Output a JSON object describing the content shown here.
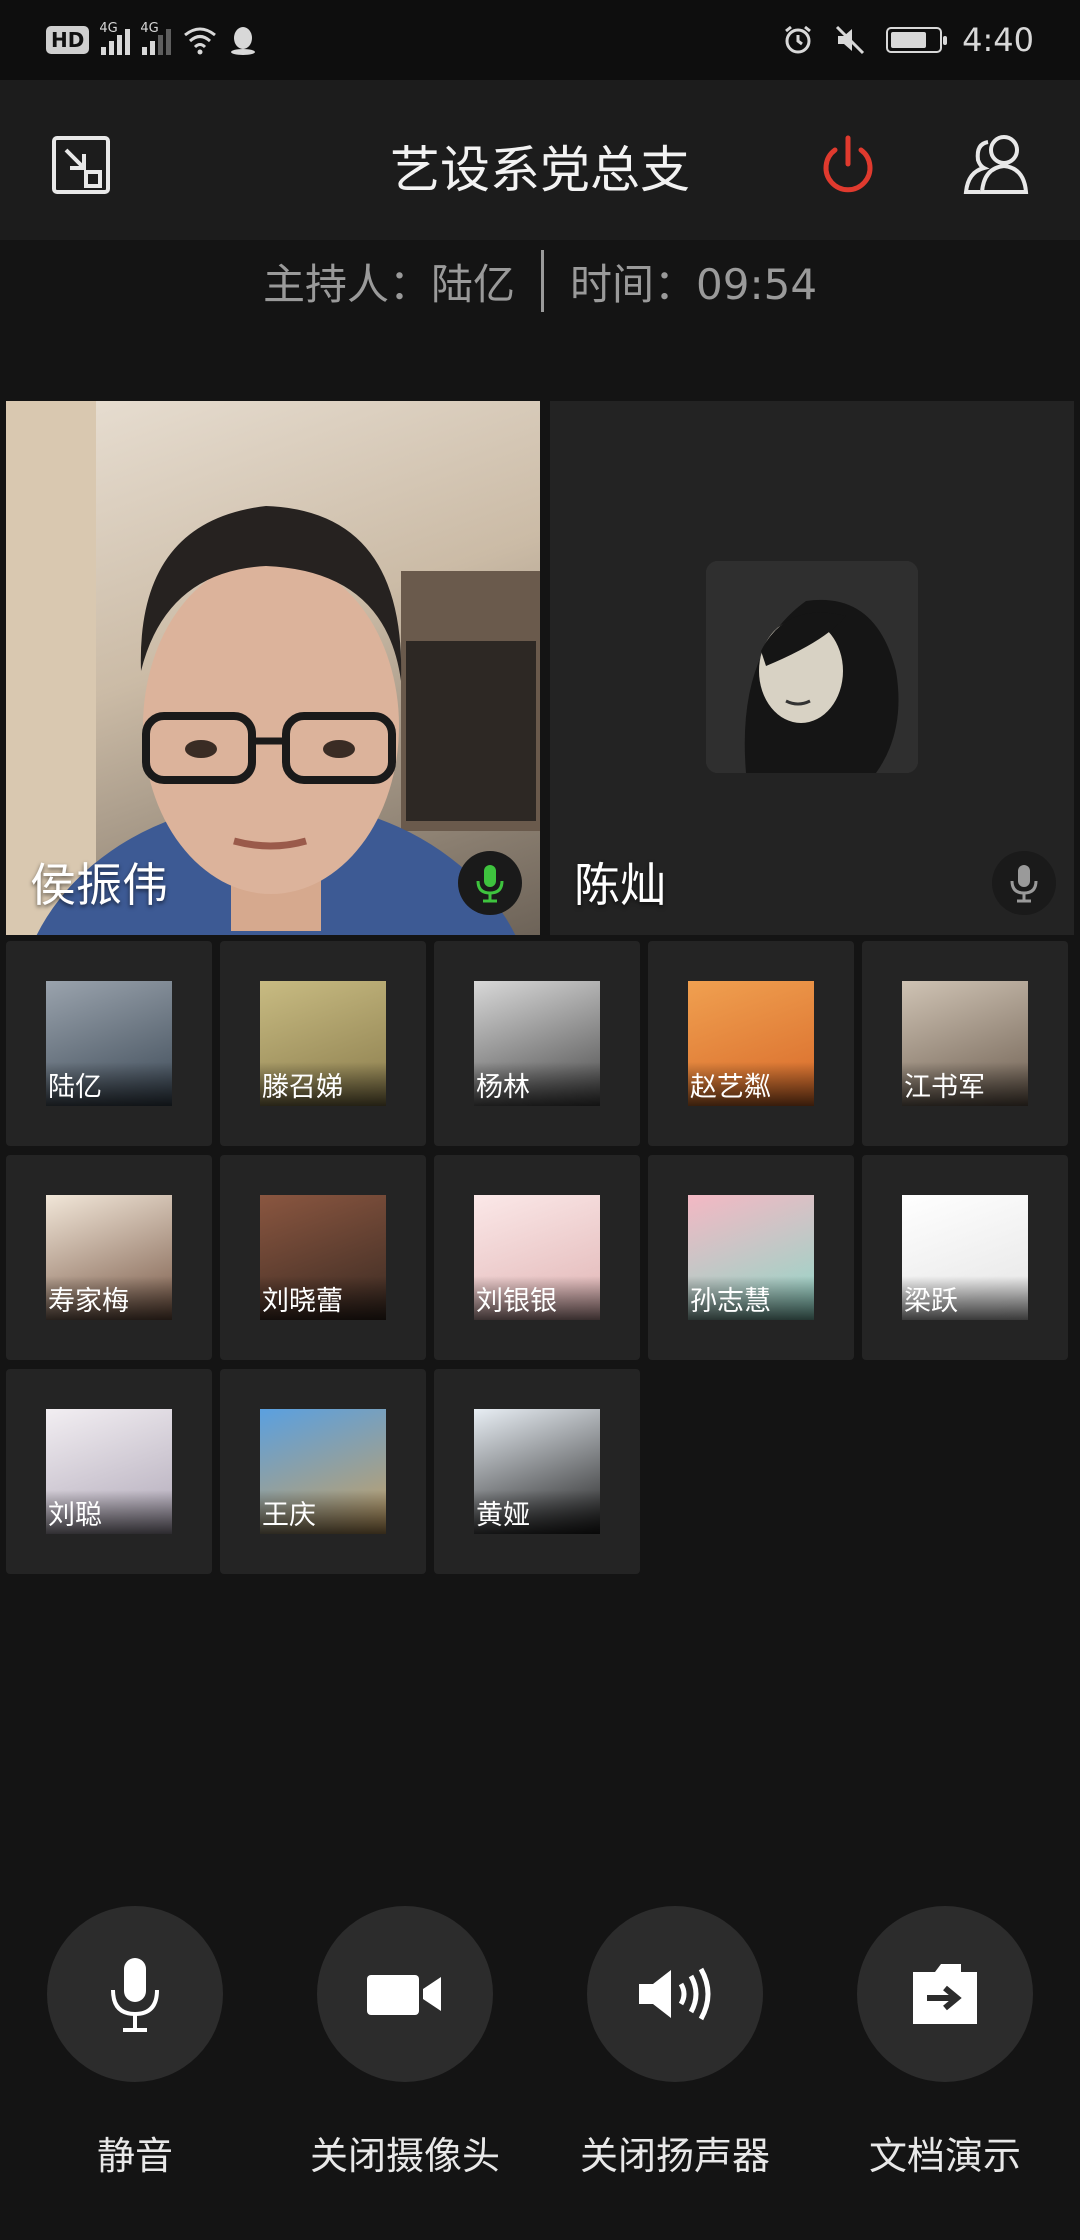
{
  "status_bar": {
    "hd": "HD",
    "network_1": "4G",
    "network_2": "4G",
    "time": "4:40",
    "battery_level": 0.75
  },
  "header": {
    "title": "艺设系党总支",
    "host_label": "主持人：",
    "host_name": "陆亿",
    "time_label": "时间：",
    "time_value": "09:54"
  },
  "main_videos": [
    {
      "name": "侯振伟",
      "mic_active": true
    },
    {
      "name": "陈灿",
      "mic_active": false
    }
  ],
  "participants": [
    {
      "name": "陆亿",
      "colors": [
        "#9aa3ad",
        "#3d4a57"
      ]
    },
    {
      "name": "滕召娣",
      "colors": [
        "#c8bb82",
        "#8a7c4c"
      ]
    },
    {
      "name": "杨林",
      "colors": [
        "#d8d8d8",
        "#4a4a4a"
      ]
    },
    {
      "name": "赵艺粼",
      "colors": [
        "#f0a050",
        "#d86a2a"
      ]
    },
    {
      "name": "江书军",
      "colors": [
        "#cfc3b4",
        "#6e5f51"
      ]
    },
    {
      "name": "寿家梅",
      "colors": [
        "#f1e6d8",
        "#7a5a48"
      ]
    },
    {
      "name": "刘晓蕾",
      "colors": [
        "#8a5640",
        "#3a2a22"
      ]
    },
    {
      "name": "刘银银",
      "colors": [
        "#fbe8e8",
        "#e0b4b4"
      ]
    },
    {
      "name": "孙志慧",
      "colors": [
        "#f4b8c4",
        "#8ed8c8"
      ]
    },
    {
      "name": "梁跃",
      "colors": [
        "#ffffff",
        "#e4e4e4"
      ]
    },
    {
      "name": "刘聪",
      "colors": [
        "#f2eef2",
        "#b0a8b8"
      ]
    },
    {
      "name": "王庆",
      "colors": [
        "#5aa0e0",
        "#c8a060"
      ]
    },
    {
      "name": "黄娅",
      "colors": [
        "#e8eef4",
        "#202020"
      ]
    }
  ],
  "controls": [
    {
      "label": "静音",
      "icon": "microphone-icon"
    },
    {
      "label": "关闭摄像头",
      "icon": "camera-icon"
    },
    {
      "label": "关闭扬声器",
      "icon": "speaker-icon"
    },
    {
      "label": "文档演示",
      "icon": "document-share-icon"
    }
  ],
  "colors": {
    "background": "#141414",
    "header": "#1c1c1c",
    "tile": "#242424",
    "end_call": "#e03a2e",
    "mic_active": "#3ec33e"
  }
}
